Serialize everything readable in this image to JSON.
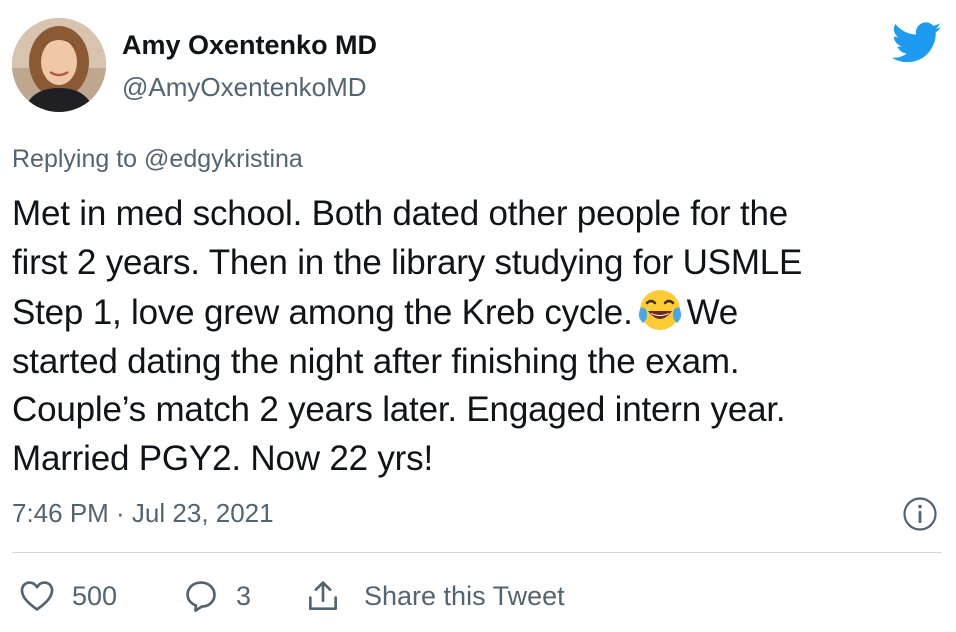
{
  "author": {
    "name": "Amy Oxentenko MD",
    "handle": "@AmyOxentenkoMD"
  },
  "reply": {
    "prefix": "Replying to",
    "mention": "@edgykristina"
  },
  "text": {
    "line1": "Met in med school. Both dated other people for the",
    "line2": "first 2 years. Then in the library studying for USMLE",
    "line3_before": "Step 1, love grew among the Kreb cycle.",
    "line3_after": "We",
    "line4": "started dating the night after finishing the exam.",
    "line5": "Couple’s match 2 years later. Engaged intern year.",
    "line6": "Married PGY2. Now 22 yrs!"
  },
  "emoji": "face-with-tears-of-joy",
  "timestamp": "7:46 PM · Jul 23, 2021",
  "actions": {
    "like_count": "500",
    "reply_count": "3",
    "share_label": "Share this Tweet"
  },
  "colors": {
    "brand": "#1d9bf0",
    "text": "#0f1419",
    "muted": "#536471",
    "divider": "#cfd9de"
  },
  "icons": [
    "twitter-bird-icon",
    "info-icon",
    "heart-icon",
    "reply-icon",
    "share-icon"
  ]
}
